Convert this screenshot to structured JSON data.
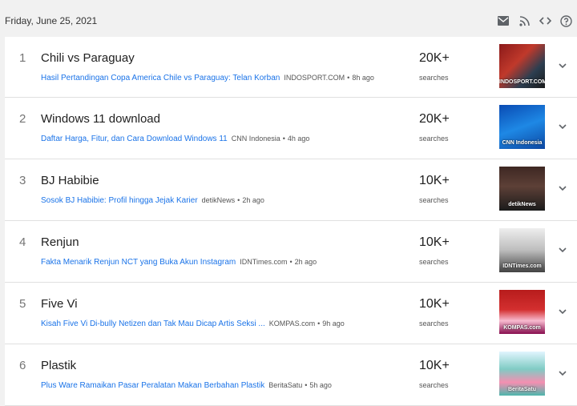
{
  "header": {
    "date": "Friday, June 25, 2021",
    "icons": [
      "email-icon",
      "rss-icon",
      "embed-code-icon",
      "help-icon"
    ]
  },
  "trends": [
    {
      "rank": "1",
      "title": "Chili vs Paraguay",
      "article": "Hasil Pertandingan Copa America Chile vs Paraguay: Telan Korban",
      "source": "INDOSPORT.COM",
      "time": "8h ago",
      "count": "20K+",
      "searches": "searches",
      "image_label": "INDOSPORT.COM",
      "image_class": "img-sport"
    },
    {
      "rank": "2",
      "title": "Windows 11 download",
      "article": "Daftar Harga, Fitur, dan Cara Download Windows 11",
      "source": "CNN Indonesia",
      "time": "4h ago",
      "count": "20K+",
      "searches": "searches",
      "image_label": "CNN Indonesia",
      "image_class": "img-win"
    },
    {
      "rank": "3",
      "title": "BJ Habibie",
      "article": "Sosok BJ Habibie: Profil hingga Jejak Karier",
      "source": "detikNews",
      "time": "2h ago",
      "count": "10K+",
      "searches": "searches",
      "image_label": "detikNews",
      "image_class": "img-habibie"
    },
    {
      "rank": "4",
      "title": "Renjun",
      "article": "Fakta Menarik Renjun NCT yang Buka Akun Instagram",
      "source": "IDNTimes.com",
      "time": "2h ago",
      "count": "10K+",
      "searches": "searches",
      "image_label": "IDNTimes.com",
      "image_class": "img-idn"
    },
    {
      "rank": "5",
      "title": "Five Vi",
      "article": "Kisah Five Vi Di-bully Netizen dan Tak Mau Dicap Artis Seksi ...",
      "source": "KOMPAS.com",
      "time": "9h ago",
      "count": "10K+",
      "searches": "searches",
      "image_label": "KOMPAS.com",
      "image_class": "img-kompas"
    },
    {
      "rank": "6",
      "title": "Plastik",
      "article": "Plus Ware Ramaikan Pasar Peralatan Makan Berbahan Plastik",
      "source": "BeritaSatu",
      "time": "5h ago",
      "count": "10K+",
      "searches": "searches",
      "image_label": "BeritaSatu",
      "image_class": "img-berita"
    }
  ],
  "row_separator": "•"
}
